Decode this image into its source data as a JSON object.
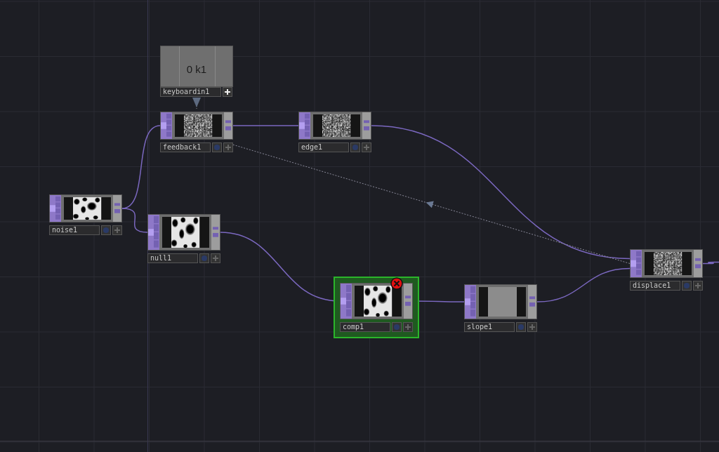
{
  "network": {
    "nodes": [
      {
        "kind": "chop",
        "name": "keyboardin1",
        "value": "0 k1"
      },
      {
        "kind": "top-static",
        "name": "feedback1",
        "selected": false,
        "error": false
      },
      {
        "kind": "top-static",
        "name": "edge1",
        "selected": false,
        "error": false
      },
      {
        "kind": "top-blobs",
        "name": "noise1",
        "selected": false,
        "error": false
      },
      {
        "kind": "top-blobs",
        "name": "null1",
        "selected": false,
        "error": false
      },
      {
        "kind": "top-blobs",
        "name": "comp1",
        "selected": true,
        "error": true
      },
      {
        "kind": "top-flat",
        "name": "slope1",
        "selected": false,
        "error": false
      },
      {
        "kind": "top-static",
        "name": "displace1",
        "selected": false,
        "error": false
      }
    ]
  }
}
